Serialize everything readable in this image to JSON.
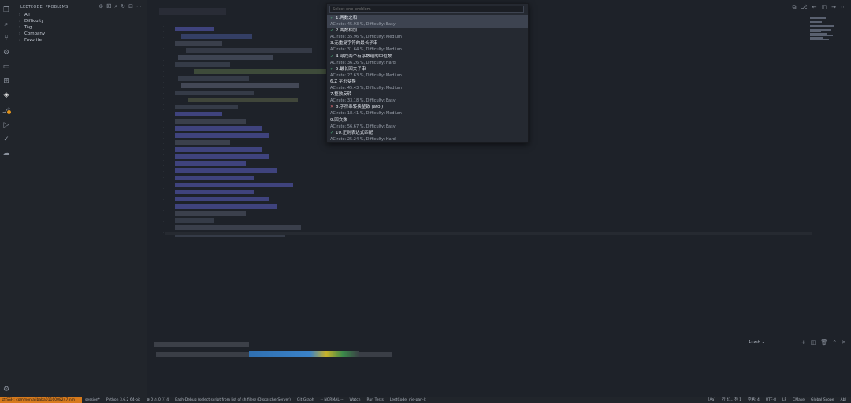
{
  "sidebar": {
    "title": "LEETCODE: PROBLEMS",
    "items": [
      {
        "label": "All"
      },
      {
        "label": "Difficulty"
      },
      {
        "label": "Tag"
      },
      {
        "label": "Company"
      },
      {
        "label": "Favorite"
      }
    ]
  },
  "quick_pick": {
    "placeholder": "Select one problem",
    "items": [
      {
        "label": "1.两数之和",
        "status": "solved",
        "detail": "AC rate: 45.93 %, Difficulty: Easy"
      },
      {
        "label": "2.两数相加",
        "status": "solved",
        "detail": "AC rate: 35.96 %, Difficulty: Medium"
      },
      {
        "label": "3.无重复字符的最长子串",
        "status": "none",
        "detail": "AC rate: 31.64 %, Difficulty: Medium"
      },
      {
        "label": "4.寻找两个有序数组的中位数",
        "status": "solved",
        "detail": "AC rate: 36.26 %, Difficulty: Hard"
      },
      {
        "label": "5.最长回文子串",
        "status": "solved",
        "detail": "AC rate: 27.63 %, Difficulty: Medium"
      },
      {
        "label": "6.Z 字形变换",
        "status": "none",
        "detail": "AC rate: 45.43 %, Difficulty: Medium"
      },
      {
        "label": "7.整数反转",
        "status": "none",
        "detail": "AC rate: 33.18 %, Difficulty: Easy"
      },
      {
        "label": "8.字符串转换整数 (atoi)",
        "status": "failed",
        "detail": "AC rate: 18.41 %, Difficulty: Medium"
      },
      {
        "label": "9.回文数",
        "status": "none",
        "detail": "AC rate: 56.67 %, Difficulty: Easy"
      },
      {
        "label": "10.正则表达式匹配",
        "status": "solved",
        "detail": "AC rate: 25.24 %, Difficulty: Hard"
      }
    ]
  },
  "terminal": {
    "selected": "1: zsh"
  },
  "status_bar": {
    "remote": "SSH: common.alibaba0116008247.nm",
    "left": [
      "session*",
      "Python 3.6.2 64-bit",
      "⊗ 0 ⚠ 0 ⓘ 4",
      "Bash-Debug (select script from list of sh files) (DispatcherServer)",
      "Git Graph",
      "-- NORMAL --",
      "Watch",
      "Run Tests",
      "LeetCode: nie-pan-lt"
    ],
    "right": [
      "[Aa]",
      "行 41，列 1",
      "空格: 4",
      "UTF-8",
      "LF",
      "CMake",
      "Global Scope",
      "Ab|"
    ]
  },
  "colors": {
    "status_remote": "#d77a1c",
    "solved_check": "#4fb57f",
    "failed_cross": "#e06c75",
    "selection": "#3d4350"
  }
}
